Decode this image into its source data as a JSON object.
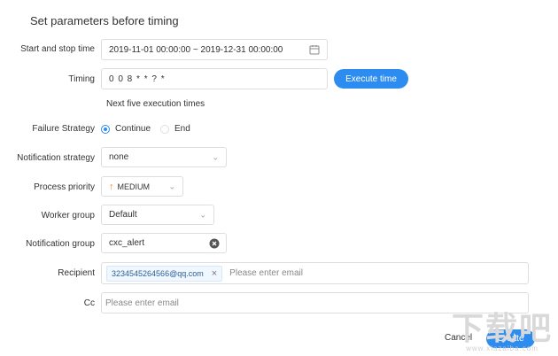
{
  "dialog": {
    "title": "Set parameters before timing",
    "start_stop": {
      "label": "Start and stop time",
      "value": "2019-11-01 00:00:00 ~ 2019-12-31 00:00:00",
      "icon": "calendar-icon"
    },
    "timing": {
      "label": "Timing",
      "value": "0 0 8 * * ? *",
      "execute_button": "Execute time",
      "next_times_label": "Next five execution times"
    },
    "failure_strategy": {
      "label": "Failure Strategy",
      "options": [
        {
          "label": "Continue",
          "selected": true
        },
        {
          "label": "End",
          "selected": false
        }
      ]
    },
    "notification_strategy": {
      "label": "Notification strategy",
      "value": "none"
    },
    "process_priority": {
      "label": "Process priority",
      "value": "MEDIUM",
      "icon": "arrow-up-icon",
      "icon_color": "#f0883a"
    },
    "worker_group": {
      "label": "Worker group",
      "value": "Default"
    },
    "notification_group": {
      "label": "Notification group",
      "value": "cxc_alert",
      "clear_icon": "clear-icon"
    },
    "recipient": {
      "label": "Recipient",
      "tags": [
        "3234545264566@qq.com"
      ],
      "placeholder": "Please enter email"
    },
    "cc": {
      "label": "Cc",
      "placeholder": "Please enter email"
    },
    "footer": {
      "cancel": "Cancel",
      "create": "Create"
    }
  },
  "watermark": {
    "main": "下载吧",
    "sub": "www.xiazaiba.com"
  },
  "colors": {
    "primary": "#2d8cf0",
    "border": "#dcdee2",
    "priority": "#f0883a"
  }
}
